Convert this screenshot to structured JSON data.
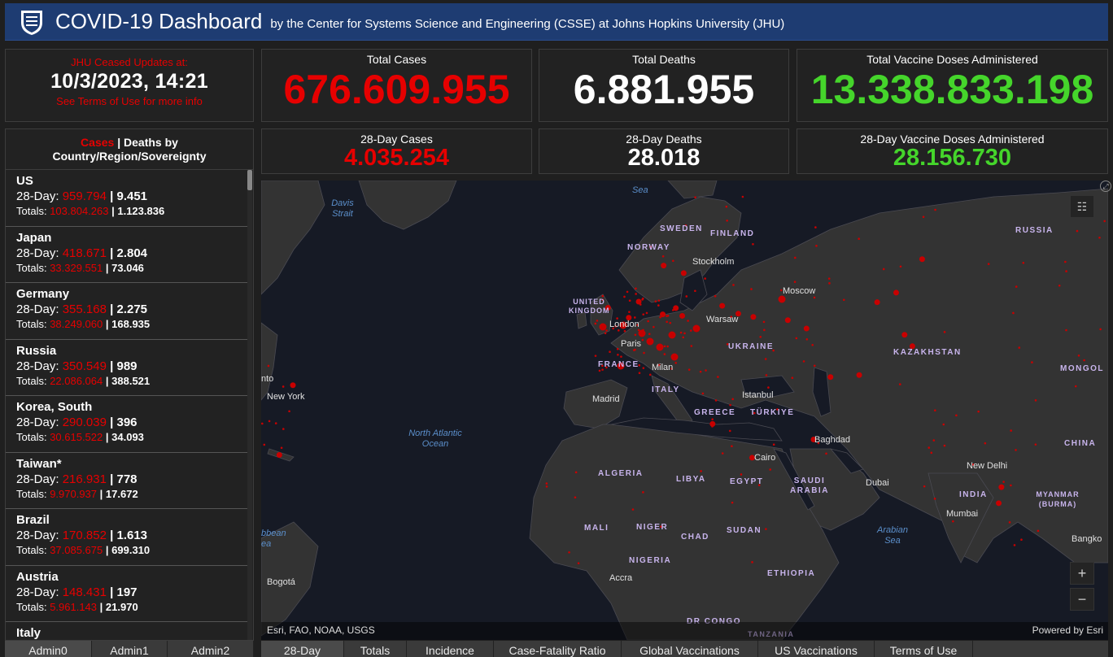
{
  "header": {
    "title": "COVID-19 Dashboard",
    "subtitle": "by the Center for Systems Science and Engineering (CSSE) at Johns Hopkins University (JHU)"
  },
  "updated": {
    "line1": "JHU Ceased Updates at:",
    "date": "10/3/2023, 14:21",
    "line3": "See Terms of Use for more info"
  },
  "stats": {
    "total_cases_label": "Total Cases",
    "total_cases": "676.609.955",
    "total_deaths_label": "Total Deaths",
    "total_deaths": "6.881.955",
    "total_vax_label": "Total Vaccine Doses Administered",
    "total_vax": "13.338.833.198",
    "cases28_label": "28-Day Cases",
    "cases28": "4.035.254",
    "deaths28_label": "28-Day Deaths",
    "deaths28": "28.018",
    "vax28_label": "28-Day Vaccine Doses Administered",
    "vax28": "28.156.730"
  },
  "list": {
    "head_cases": "Cases",
    "head_sep": " | ",
    "head_rest": "Deaths by",
    "head_line2": "Country/Region/Sovereignty",
    "day_prefix": "28-Day: ",
    "tot_prefix": "Totals: ",
    "sep": " | ",
    "rows": [
      {
        "name": "US",
        "c28": "959.794",
        "d28": "9.451",
        "ct": "103.804.263",
        "dt": "1.123.836"
      },
      {
        "name": "Japan",
        "c28": "418.671",
        "d28": "2.804",
        "ct": "33.329.551",
        "dt": "73.046"
      },
      {
        "name": "Germany",
        "c28": "355.168",
        "d28": "2.275",
        "ct": "38.249.060",
        "dt": "168.935"
      },
      {
        "name": "Russia",
        "c28": "350.549",
        "d28": "989",
        "ct": "22.086.064",
        "dt": "388.521"
      },
      {
        "name": "Korea, South",
        "c28": "290.039",
        "d28": "396",
        "ct": "30.615.522",
        "dt": "34.093"
      },
      {
        "name": "Taiwan*",
        "c28": "216.931",
        "d28": "778",
        "ct": "9.970.937",
        "dt": "17.672"
      },
      {
        "name": "Brazil",
        "c28": "170.852",
        "d28": "1.613",
        "ct": "37.085.675",
        "dt": "699.310"
      },
      {
        "name": "Austria",
        "c28": "148.431",
        "d28": "197",
        "ct": "5.961.143",
        "dt": "21.970"
      },
      {
        "name": "Italy",
        "c28": "",
        "d28": "",
        "ct": "",
        "dt": ""
      }
    ]
  },
  "map": {
    "countries": [
      "SWEDEN",
      "FINLAND",
      "NORWAY",
      "UNITED KINGDOM",
      "RUSSIA",
      "UKRAINE",
      "KAZAKHSTAN",
      "MONGOL",
      "FRANCE",
      "ITALY",
      "GREECE",
      "TÜRKIYE",
      "CHINA",
      "ALGERIA",
      "LIBYA",
      "EGYPT",
      "SAUDI ARABIA",
      "INDIA",
      "MYANMAR (BURMA)",
      "MALI",
      "NIGER",
      "CHAD",
      "SUDAN",
      "NIGERIA",
      "ETHIOPIA",
      "DR CONGO",
      "TANZANIA"
    ],
    "cities": [
      "Stockholm",
      "Moscow",
      "London",
      "Warsaw",
      "Paris",
      "Milan",
      "New York",
      "Madrid",
      "Istanbul",
      "Baghdad",
      "Cairo",
      "Dubai",
      "New Delhi",
      "Mumbai",
      "Bangko",
      "Bogotá",
      "Accra",
      "nto"
    ],
    "seas": [
      "Davis Strait",
      "North Atlantic Ocean",
      "Arabian Sea",
      "Sea",
      "bbean",
      "ea"
    ],
    "attribution": "Esri, FAO, NOAA, USGS",
    "powered": "Powered by Esri",
    "zoom_in": "+",
    "zoom_out": "−"
  },
  "tabs_left": [
    "Admin0",
    "Admin1",
    "Admin2"
  ],
  "tabs_right": [
    "28-Day",
    "Totals",
    "Incidence",
    "Case-Fatality Ratio",
    "Global Vaccinations",
    "US Vaccinations",
    "Terms of Use"
  ],
  "colors": {
    "header": "#1e3c72",
    "cases": "#e60000",
    "vaccine": "#45d52b",
    "map": "#161a25"
  }
}
